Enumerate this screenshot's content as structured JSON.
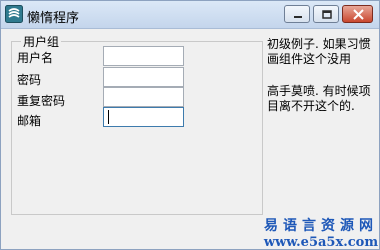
{
  "window": {
    "title": "懒惰程序"
  },
  "icons": {
    "app": "app-logo-icon",
    "minimize": "minimize-icon",
    "maximize": "maximize-icon",
    "close": "close-icon"
  },
  "colors": {
    "titlebar": "#c4d5ec",
    "close_button": "#c9472f",
    "watermark": "#1e58b8",
    "focus_border": "#3d7bad"
  },
  "group": {
    "label": "用户组",
    "fields": [
      {
        "label": "用户名",
        "value": ""
      },
      {
        "label": "密码",
        "value": ""
      },
      {
        "label": "重复密码",
        "value": ""
      },
      {
        "label": "邮箱",
        "value": ""
      }
    ]
  },
  "notes": {
    "first": "初级例子. 如果习惯画组件这个没用",
    "second": "高手莫喷. 有时候项目离不开这个的."
  },
  "watermark": {
    "name": "易语言资源网",
    "url": "www.e5a5x.com"
  }
}
